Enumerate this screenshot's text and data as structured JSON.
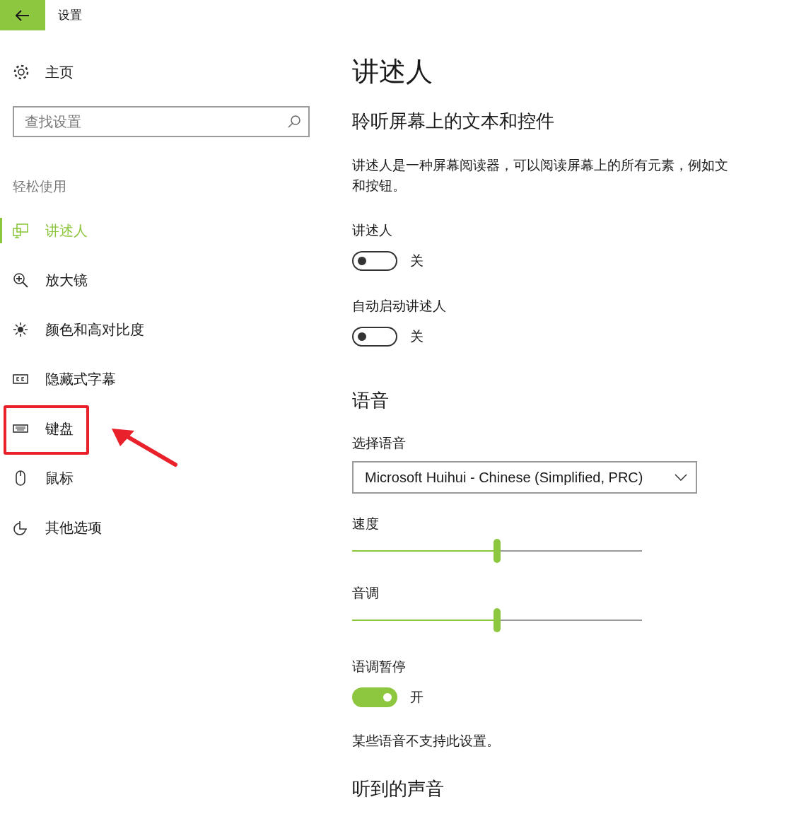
{
  "window": {
    "title": "设置"
  },
  "sidebar": {
    "home": "主页",
    "search": {
      "placeholder": "查找设置"
    },
    "group": "轻松使用",
    "items": [
      {
        "label": "讲述人",
        "selected": true
      },
      {
        "label": "放大镜",
        "selected": false
      },
      {
        "label": "颜色和高对比度",
        "selected": false
      },
      {
        "label": "隐藏式字幕",
        "selected": false
      },
      {
        "label": "键盘",
        "selected": false
      },
      {
        "label": "鼠标",
        "selected": false
      },
      {
        "label": "其他选项",
        "selected": false
      }
    ]
  },
  "content": {
    "title": "讲述人",
    "subtitle": "聆听屏幕上的文本和控件",
    "items": [
      {
        "kind": "paragraph",
        "lines": [
          "讲述人是一种屏幕阅读器，可以阅读屏幕上的所有元素，例如文",
          "和按钮。"
        ]
      },
      {
        "kind": "toggle",
        "label": "讲述人",
        "on": false,
        "state_text": "关"
      },
      {
        "kind": "toggle",
        "label": "自动启动讲述人",
        "on": false,
        "state_text": "关"
      },
      {
        "kind": "heading",
        "text": "语音"
      },
      {
        "kind": "dropdown",
        "label": "选择语音",
        "value": "Microsoft Huihui - Chinese (Simplified, PRC)"
      },
      {
        "kind": "slider",
        "label": "速度",
        "level": 0.5
      },
      {
        "kind": "slider",
        "label": "音调",
        "level": 0.5
      },
      {
        "kind": "toggle",
        "label": "语调暂停",
        "on": true,
        "state_text": "开"
      },
      {
        "kind": "note",
        "text": "某些语音不支持此设置。"
      },
      {
        "kind": "heading",
        "text": "听到的声音"
      }
    ]
  }
}
